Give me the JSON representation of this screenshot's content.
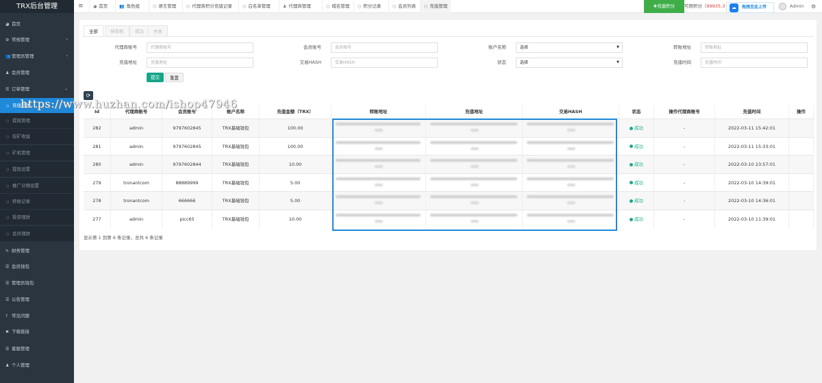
{
  "app_title": "TRX后台管理",
  "sidebar": {
    "items": [
      {
        "label": "首页",
        "icon": "dashboard-icon"
      },
      {
        "label": "常规管理",
        "icon": "gears-icon"
      },
      {
        "label": "管理员管理",
        "icon": "group-icon"
      },
      {
        "label": "会员管理",
        "icon": "user-icon"
      },
      {
        "label": "订单管理",
        "icon": "list-icon"
      },
      {
        "label": "充值管理",
        "icon": "circle-icon"
      },
      {
        "label": "提现管理",
        "icon": "circle-icon"
      },
      {
        "label": "挖矿收益",
        "icon": "circle-icon"
      },
      {
        "label": "矿机管理",
        "icon": "circle-icon"
      },
      {
        "label": "提现设置",
        "icon": "circle-icon"
      },
      {
        "label": "推广分佣设置",
        "icon": "circle-icon"
      },
      {
        "label": "转账记录",
        "icon": "circle-icon"
      },
      {
        "label": "投资理财",
        "icon": "circle-icon"
      },
      {
        "label": "会员理财",
        "icon": "circle-icon"
      },
      {
        "label": "财务管理",
        "icon": "edit-icon"
      },
      {
        "label": "会员钱包",
        "icon": "list-icon"
      },
      {
        "label": "管理员钱包",
        "icon": "list-icon"
      },
      {
        "label": "公告管理",
        "icon": "list-icon"
      },
      {
        "label": "常见问题",
        "icon": "question-icon"
      },
      {
        "label": "下载链接",
        "icon": "close-icon"
      },
      {
        "label": "客服管理",
        "icon": "list-icon"
      },
      {
        "label": "个人管理",
        "icon": "user-icon"
      }
    ]
  },
  "topbar": {
    "menu_icon": "≡",
    "tabs": [
      {
        "label": "首页",
        "icon": "dashboard-icon"
      },
      {
        "label": "角色组",
        "icon": "group-icon"
      },
      {
        "label": "语言管理",
        "icon": "circle-icon"
      },
      {
        "label": "代理商积分充值记录",
        "icon": "circle-icon"
      },
      {
        "label": "白名单管理",
        "icon": "circle-icon"
      },
      {
        "label": "代理商管理",
        "icon": "user-icon"
      },
      {
        "label": "域名管理",
        "icon": "circle-icon"
      },
      {
        "label": "积分记录",
        "icon": "circle-icon"
      },
      {
        "label": "会员列表",
        "icon": "circle-icon"
      },
      {
        "label": "充值管理",
        "icon": "circle-icon"
      }
    ],
    "recharge_button": "✚充值积分",
    "credit_label": "可用积分（",
    "credit_value": "99935.3",
    "upload_label": "拖拽至此上传",
    "admin_name": "Admin"
  },
  "filter_tabs": [
    "全部",
    "待审核",
    "成功",
    "失败"
  ],
  "filters": {
    "agent_no": {
      "label": "代理商账号",
      "placeholder": "代理商账号"
    },
    "member_no": {
      "label": "会员账号",
      "placeholder": "会员账号"
    },
    "account_name": {
      "label": "账户名称",
      "value": "选择"
    },
    "transfer_addr": {
      "label": "转账地址",
      "placeholder": "转账地址"
    },
    "recharge_addr": {
      "label": "充值地址",
      "placeholder": "充值地址"
    },
    "tx_hash": {
      "label": "交易HASH",
      "placeholder": "交易HASH"
    },
    "status": {
      "label": "状态",
      "value": "选择"
    },
    "recharge_time": {
      "label": "充值时间",
      "placeholder": "充值时间"
    },
    "submit": "提交",
    "reset": "重置"
  },
  "table": {
    "columns": [
      "Id",
      "代理商账号",
      "会员账号",
      "账户名称",
      "充值金额（TRX）",
      "转账地址",
      "充值地址",
      "交易HASH",
      "状态",
      "操作代理商账号",
      "充值时间",
      "操作"
    ],
    "rows": [
      {
        "id": "282",
        "agent": "admin",
        "member": "9797602845",
        "account": "TRX基础钱包",
        "amount": "100.00",
        "status": "成功",
        "op_agent": "-",
        "time": "2022-03-11 15:42:01"
      },
      {
        "id": "281",
        "agent": "admin",
        "member": "9797602845",
        "account": "TRX基础钱包",
        "amount": "100.00",
        "status": "成功",
        "op_agent": "-",
        "time": "2022-03-11 15:33:01"
      },
      {
        "id": "280",
        "agent": "admin",
        "member": "9797602844",
        "account": "TRX基础钱包",
        "amount": "10.00",
        "status": "成功",
        "op_agent": "-",
        "time": "2022-03-10 23:57:01"
      },
      {
        "id": "279",
        "agent": "tronantcom",
        "member": "88889999",
        "account": "TRX基础钱包",
        "amount": "5.00",
        "status": "成功",
        "op_agent": "-",
        "time": "2022-03-10 14:39:01"
      },
      {
        "id": "278",
        "agent": "tronantcom",
        "member": "666666",
        "account": "TRX基础钱包",
        "amount": "5.00",
        "status": "成功",
        "op_agent": "-",
        "time": "2022-03-10 14:36:01"
      },
      {
        "id": "277",
        "agent": "admin",
        "member": "picc65",
        "account": "TRX基础钱包",
        "amount": "10.00",
        "status": "成功",
        "op_agent": "-",
        "time": "2022-03-10 11:39:01"
      }
    ],
    "footer": "显示第 1 到第 6 条记录，总共 6 条记录"
  },
  "watermark": "https://www.huzhan.com/ishop47946",
  "colors": {
    "sidebar": "#2b3540",
    "active": "#1e88d9",
    "success": "#19aa8d",
    "recharge_btn": "#3fae49"
  }
}
